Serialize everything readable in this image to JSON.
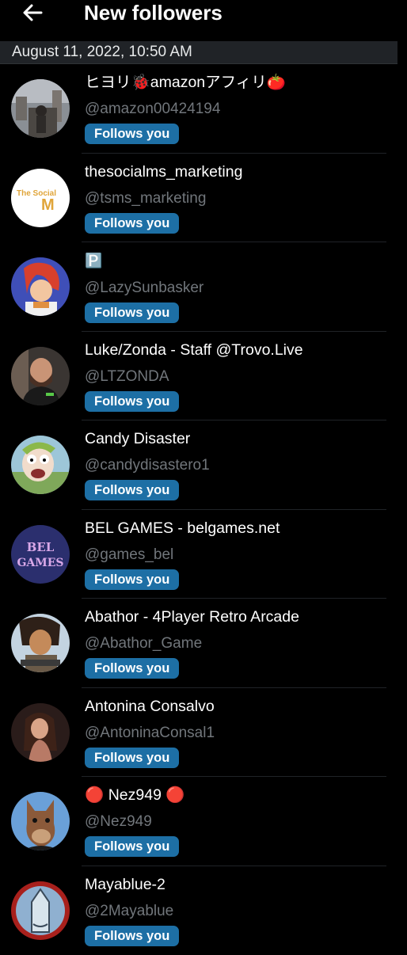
{
  "header": {
    "title": "New followers",
    "back_icon": "arrow-left-icon"
  },
  "date": "August 11, 2022, 10:50 AM",
  "badge_label": "Follows you",
  "colors": {
    "badge": "#1d6fa5",
    "background": "#000000",
    "handle": "#71767b"
  },
  "followers": [
    {
      "name": "ヒヨリ🐞amazonアフィリ🍅",
      "handle": "@amazon00424194"
    },
    {
      "name": "thesocialms_marketing",
      "handle": "@tsms_marketing"
    },
    {
      "name": "🅿️",
      "handle": "@LazySunbasker"
    },
    {
      "name": "Luke/Zonda - Staff @Trovo.Live",
      "handle": "@LTZONDA"
    },
    {
      "name": "Candy Disaster",
      "handle": "@candydisastero1"
    },
    {
      "name": "BEL GAMES - belgames.net",
      "handle": "@games_bel"
    },
    {
      "name": "Abathor - 4Player Retro Arcade",
      "handle": "@Abathor_Game"
    },
    {
      "name": "Antonina Consalvo",
      "handle": "@AntoninaConsal1"
    },
    {
      "name": "🔴 Nez949 🔴",
      "handle": "@Nez949"
    },
    {
      "name": "Mayablue-2",
      "handle": "@2Mayablue"
    }
  ],
  "avatars": {
    "bel_text_1": "BEL",
    "bel_text_2": "GAMES",
    "social_text_1": "The Social",
    "social_text_2": "M"
  }
}
